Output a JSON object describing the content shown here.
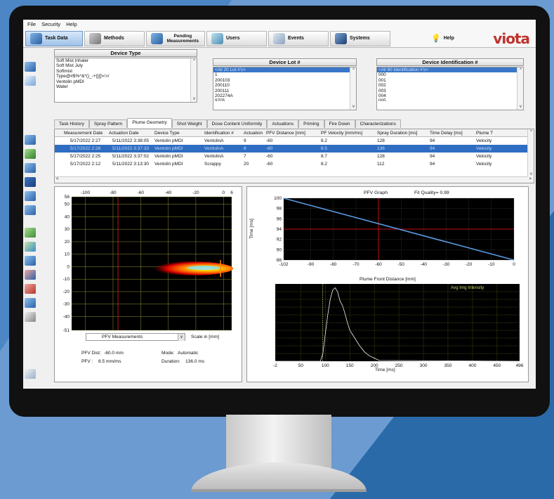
{
  "menu": [
    "File",
    "Security",
    "Help"
  ],
  "toolbar": [
    {
      "label": "Task Data",
      "icon": "task-data-icon",
      "active": true
    },
    {
      "label": "Methods",
      "icon": "methods-icon"
    },
    {
      "label": "Pending Measurements",
      "icon": "pending-measurements-icon"
    },
    {
      "label": "Users",
      "icon": "users-icon"
    },
    {
      "label": "Events",
      "icon": "events-icon"
    },
    {
      "label": "Systems",
      "icon": "systems-icon"
    }
  ],
  "help": "Help",
  "logo": "viota",
  "device_type": {
    "header": "Device Type",
    "items": [
      "Soft Mist Inhaler",
      "Soft Mist July",
      "Softmist",
      "Type@#$%^&*()_-+{}[]\\<>/",
      "Ventolin pMDI",
      "Water"
    ]
  },
  "device_lot": {
    "header": "Device Lot #",
    "items": [
      "<All 20 Lot #'s>",
      "1",
      "200103",
      "200110",
      "200111",
      "202274A",
      "9705"
    ]
  },
  "device_id": {
    "header": "Device Identification #",
    "items": [
      "<All 60 Identification #'s>",
      "000",
      "001",
      "002",
      "003",
      "004",
      "005"
    ]
  },
  "tabs": [
    "Task History",
    "Spray Pattern",
    "Plume Geometry",
    "Shot Weight",
    "Dose Content Uniformity",
    "Actuations",
    "Priming",
    "Fire Down",
    "Characterizations"
  ],
  "active_tab": "Plume Geometry",
  "table": {
    "headers": [
      "Measurement Date",
      "Actuation Date",
      "Device Type",
      "Identification #",
      "Actuation N",
      "PFV Distance [mm]",
      "PF Velocity [mm/ms]",
      "Spray Duration [ms]",
      "Time Delay [ms]",
      "Plume T"
    ],
    "rows": [
      [
        "5/17/2022 2:27",
        "5/11/2022 3:38:05",
        "Ventolin pMDI",
        "VentolinA",
        "9",
        "-60",
        "8.2",
        "128",
        "94",
        "Velocity"
      ],
      [
        "5/17/2022 2:26",
        "5/11/2022 3:37:33",
        "Ventolin pMDI",
        "VentolinA",
        "8",
        "-60",
        "8.5",
        "136",
        "94",
        "Velocity"
      ],
      [
        "5/17/2022 2:25",
        "5/11/2022 3:37:02",
        "Ventolin pMDI",
        "VentolinA",
        "7",
        "-60",
        "8.7",
        "128",
        "94",
        "Velocity"
      ],
      [
        "5/17/2022 2:12",
        "5/11/2022 3:13:30",
        "Ventolin pMDI",
        "Scrappy",
        "20",
        "-60",
        "8.2",
        "112",
        "94",
        "Velocity"
      ]
    ]
  },
  "plume": {
    "xticks": [
      "-100",
      "-80",
      "-60",
      "-40",
      "-20",
      "0",
      "6"
    ],
    "yticks": [
      "56",
      "50",
      "40",
      "30",
      "20",
      "10",
      "0",
      "-10",
      "-20",
      "-30",
      "-40",
      "-51"
    ],
    "dropdown": "PFV Measurements",
    "scale_label": "Scale in [mm]",
    "pfv_dist_label": "PFV Dist:",
    "pfv_dist": "-60.0  mm",
    "pfv_label": "PFV :",
    "pfv": "8.5  mm/ms",
    "mode_label": "Mode:",
    "mode": "Automatic",
    "duration_label": "Duration:",
    "duration": "136.0  ms"
  },
  "chart_data": [
    {
      "type": "line",
      "title": "PFV Graph",
      "subtitle": "Fit Quality= 0.99",
      "xlabel": "Plume Front Distance [mm]",
      "ylabel": "Time [ms]",
      "xlim": [
        -102,
        0
      ],
      "ylim": [
        88,
        100
      ],
      "xticks": [
        "-102",
        "-90",
        "-80",
        "-70",
        "-60",
        "-50",
        "-40",
        "-30",
        "-20",
        "-10",
        "0"
      ],
      "yticks": [
        "100",
        "98",
        "96",
        "94",
        "92",
        "90",
        "88"
      ],
      "x": [
        -102,
        0
      ],
      "y": [
        100,
        88
      ],
      "markers": {
        "x": -60,
        "y": 94
      }
    },
    {
      "type": "line",
      "xlabel": "Time [ms]",
      "legend": "Avg Img Intensity",
      "legend_position": "top-right",
      "xticks": [
        "-2",
        "50",
        "100",
        "150",
        "200",
        "250",
        "300",
        "350",
        "400",
        "450",
        "496"
      ],
      "xlim": [
        -2,
        496
      ],
      "x": [
        -2,
        90,
        95,
        100,
        105,
        110,
        115,
        120,
        125,
        130,
        135,
        140,
        145,
        150,
        160,
        170,
        180,
        190,
        200,
        210,
        496
      ],
      "y": [
        0,
        0,
        10,
        35,
        60,
        80,
        92,
        95,
        90,
        78,
        72,
        62,
        50,
        40,
        30,
        20,
        12,
        7,
        4,
        1,
        0
      ]
    }
  ]
}
